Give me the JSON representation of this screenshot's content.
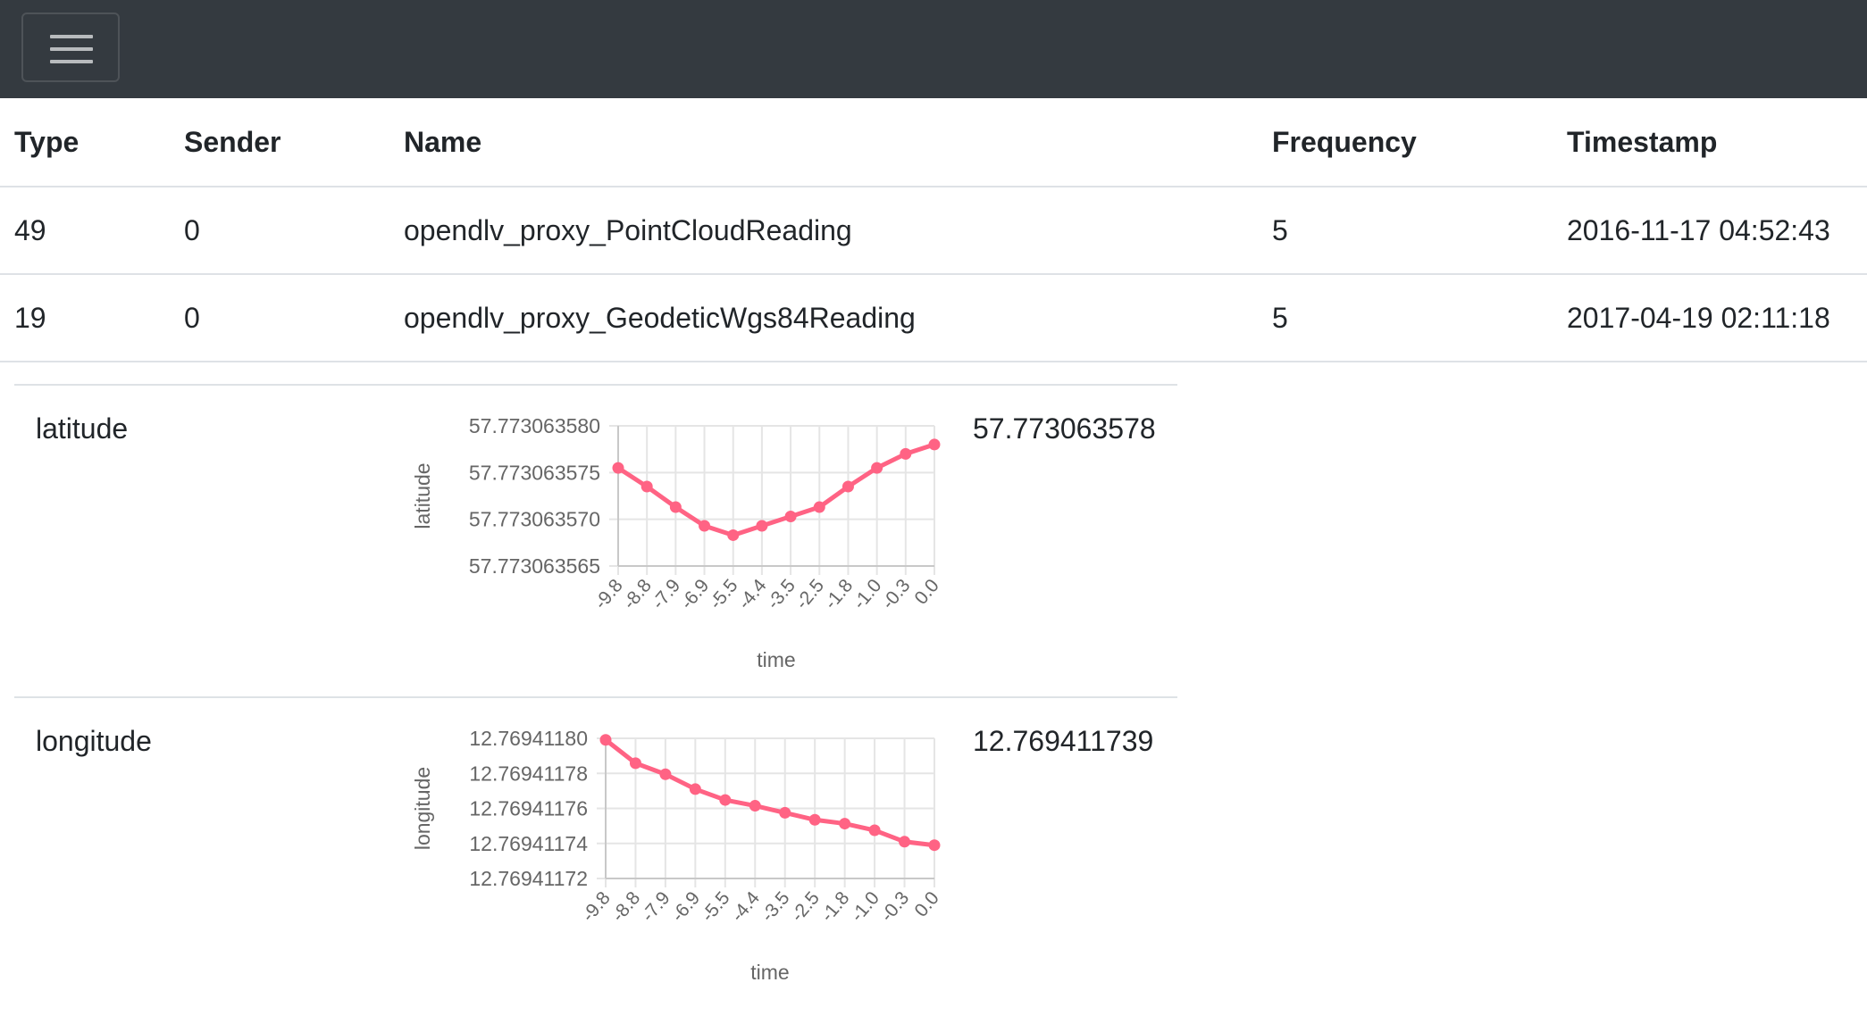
{
  "navbar": {
    "toggle_icon": "hamburger-icon"
  },
  "table": {
    "headers": [
      "Type",
      "Sender",
      "Name",
      "Frequency",
      "Timestamp"
    ],
    "rows": [
      [
        "49",
        "0",
        "opendlv_proxy_PointCloudReading",
        "5",
        "2016-11-17 04:52:43"
      ],
      [
        "19",
        "0",
        "opendlv_proxy_GeodeticWgs84Reading",
        "5",
        "2017-04-19 02:11:18"
      ]
    ]
  },
  "signals": [
    {
      "label": "latitude",
      "value": "57.773063578"
    },
    {
      "label": "longitude",
      "value": "12.769411739"
    }
  ],
  "colors": {
    "navbar": "#343a40",
    "series": "#ff6384",
    "grid": "#e5e5e5",
    "axis_text": "#666666"
  },
  "chart_data": [
    {
      "type": "line",
      "ylabel": "latitude",
      "xlabel": "time",
      "x": [
        "-9.8",
        "-8.8",
        "-7.9",
        "-6.9",
        "-5.5",
        "-4.4",
        "-3.5",
        "-2.5",
        "-1.8",
        "-1.0",
        "-0.3",
        "0.0"
      ],
      "yticks": [
        "57.773063580",
        "57.773063575",
        "57.773063570",
        "57.773063565"
      ],
      "ylim": [
        57.773063565,
        57.77306358
      ],
      "values": [
        57.7730635755,
        57.7730635735,
        57.7730635713,
        57.7730635693,
        57.7730635683,
        57.7730635693,
        57.7730635703,
        57.7730635713,
        57.7730635735,
        57.7730635755,
        57.773063577,
        57.773063578
      ],
      "grid": true,
      "legend": "none"
    },
    {
      "type": "line",
      "ylabel": "longitude",
      "xlabel": "time",
      "x": [
        "-9.8",
        "-8.8",
        "-7.9",
        "-6.9",
        "-5.5",
        "-4.4",
        "-3.5",
        "-2.5",
        "-1.8",
        "-1.0",
        "-0.3",
        "0.0"
      ],
      "yticks": [
        "12.76941180",
        "12.76941178",
        "12.76941176",
        "12.76941174",
        "12.76941172"
      ],
      "ylim": [
        12.76941172,
        12.7694118
      ],
      "values": [
        12.7694117991,
        12.7694117858,
        12.7694117795,
        12.769411771,
        12.7694117648,
        12.7694117615,
        12.7694117575,
        12.7694117535,
        12.7694117513,
        12.7694117475,
        12.769411741,
        12.769411739
      ],
      "grid": true,
      "legend": "none"
    }
  ]
}
